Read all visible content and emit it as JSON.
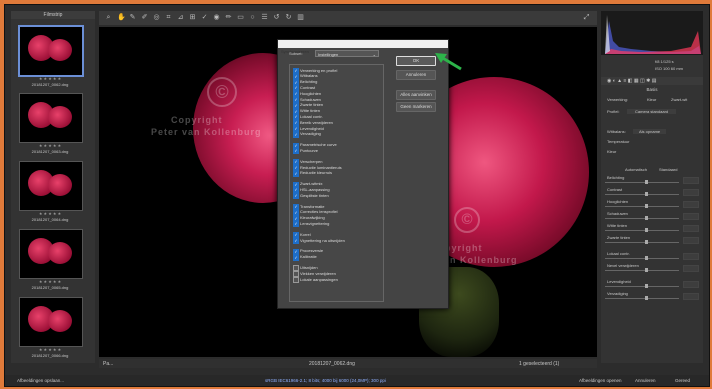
{
  "filmstrip": {
    "title": "Filmstrip",
    "thumbnails": [
      {
        "caption": "20181207_0062.dng",
        "selected": true
      },
      {
        "caption": "20181207_0063.dng",
        "selected": false
      },
      {
        "caption": "20181207_0064.dng",
        "selected": false
      },
      {
        "caption": "20181207_0065.dng",
        "selected": false
      },
      {
        "caption": "20181207_0066.dng",
        "selected": false
      }
    ],
    "stars": "★ ★ ★ ★ ★"
  },
  "watermark": {
    "symbol": "©",
    "line1": "Copyright",
    "line2": "Peter van Kollenburg"
  },
  "dialog": {
    "title": "Synchroniseren",
    "subset_label": "Subset:",
    "subset_value": "Instellingen",
    "ok": "OK",
    "cancel": "Annuleren",
    "select_all": "Alles aanvinken",
    "select_none": "Geen markeren",
    "group1": [
      "Verwerking en profiel",
      "Witbalans",
      "Belichting",
      "Contrast",
      "Hooglichten",
      "Schaduwen",
      "Zwarte tinten",
      "Witte tinten",
      "Lokaal contr.",
      "Bereik verwijderen",
      "Levendigheid",
      "Verzadiging"
    ],
    "group2": [
      "Parametrische curve",
      "Puntcurve"
    ],
    "group3": [
      "Verscherpen",
      "Reductie luminantieruis",
      "Reductie kleurruis"
    ],
    "group4": [
      "Zwart-witmix",
      "HSL-aanpassing",
      "Gesplitste tinten"
    ],
    "group5": [
      "Transformatie",
      "Correcties lensprofiel",
      "Kleurafwijking",
      "Lensvignettering"
    ],
    "group6": [
      "Korrel",
      "Vignettering na uitsnijden"
    ],
    "group7": [
      "Procesversie",
      "Kalibratie"
    ],
    "group8": [
      "Uitsnijden",
      "Vlekken verwijderen",
      "Lokale aanpassingen"
    ]
  },
  "right_panel": {
    "title": "Basis",
    "processing": "Verwerking:",
    "color": "Kleur",
    "bw": "Zwart-wit",
    "profile_label": "Profiel:",
    "profile_value": "Camera standaard",
    "wb_label": "Witbalans:",
    "wb_value": "Als opname",
    "temp": "Temperatuur",
    "tint": "Kleur",
    "auto": "Automatisch",
    "default": "Standaard",
    "sliders": [
      "Belichting",
      "Contrast",
      "Hooglichten",
      "Schaduwen",
      "Witte tinten",
      "Zwarte tinten",
      "Lokaal contr.",
      "Nevel verwijderen",
      "Levendigheid",
      "Verzadiging"
    ],
    "exif1": "f/8  1/125 s",
    "exif2": "ISO 100  60 mm"
  },
  "preview_caption": "20181207_0062.dng",
  "zoom": "Pa...",
  "status": {
    "left": "Afbeeldingen opslaan...",
    "center": "sRGB IEC61966-2.1; 8 bits; 4000 bij 6000 (24,0MP); 300 ppi",
    "open": "Afbeeldingen openen",
    "cancel": "Annuleren",
    "done": "Gereed"
  },
  "selection_count": "1 geselecteerd (1)",
  "colors": {
    "accent": "#1e6ec8",
    "arrow": "#2db34a",
    "frame": "#e07a3a"
  }
}
